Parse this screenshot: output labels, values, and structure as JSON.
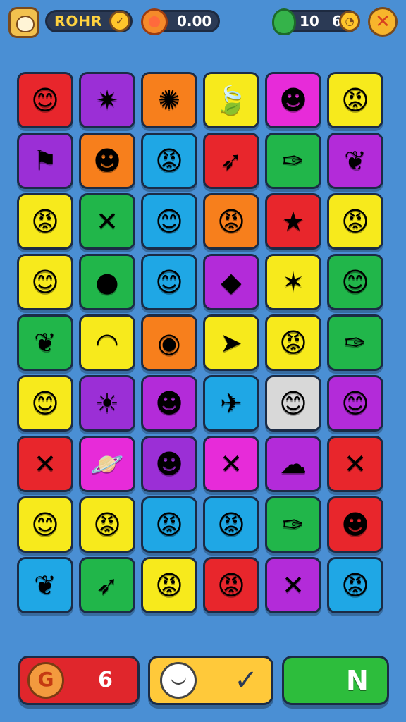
{
  "header": {
    "player_name": "ROHR",
    "name_badge_icon": "coin-icon",
    "score": "0.00",
    "lives": "10",
    "moves": "6",
    "close_icon": "close-icon",
    "close_label": "✕",
    "coin_label": "✓"
  },
  "board": {
    "rows": 9,
    "cols": 6,
    "tiles": [
      {
        "color": "#e8262c",
        "icon": "sun-face",
        "glyph": "😊"
      },
      {
        "color": "#9b2fd6",
        "icon": "star-burst",
        "glyph": "✷"
      },
      {
        "color": "#f77f1c",
        "icon": "splash",
        "glyph": "✺"
      },
      {
        "color": "#f7ea1c",
        "icon": "leaf",
        "glyph": "🍃"
      },
      {
        "color": "#e72bd9",
        "icon": "blue-face",
        "glyph": "☻"
      },
      {
        "color": "#f7ea1c",
        "icon": "red-sun-face",
        "glyph": "😡"
      },
      {
        "color": "#9b2fd6",
        "icon": "flag",
        "glyph": "⚑"
      },
      {
        "color": "#f77f1c",
        "icon": "green-face",
        "glyph": "☻"
      },
      {
        "color": "#1fa7e5",
        "icon": "red-sun-face",
        "glyph": "😡"
      },
      {
        "color": "#e8262c",
        "icon": "rocket",
        "glyph": "➶"
      },
      {
        "color": "#21b64a",
        "icon": "carrot",
        "glyph": "✑"
      },
      {
        "color": "#b32bd9",
        "icon": "leaf",
        "glyph": "❦"
      },
      {
        "color": "#f7ea1c",
        "icon": "red-sun-face",
        "glyph": "😡"
      },
      {
        "color": "#21b64a",
        "icon": "cross-sword",
        "glyph": "✕"
      },
      {
        "color": "#1fa7e5",
        "icon": "orange-sun-face",
        "glyph": "😊"
      },
      {
        "color": "#f77f1c",
        "icon": "red-sun-face",
        "glyph": "😡"
      },
      {
        "color": "#e8262c",
        "icon": "star",
        "glyph": "★"
      },
      {
        "color": "#f7ea1c",
        "icon": "red-sun-face",
        "glyph": "😡"
      },
      {
        "color": "#f7ea1c",
        "icon": "sun-face",
        "glyph": "😊"
      },
      {
        "color": "#21b64a",
        "icon": "orange-coin",
        "glyph": "●"
      },
      {
        "color": "#1fa7e5",
        "icon": "orange-sun-face",
        "glyph": "😊"
      },
      {
        "color": "#b32bd9",
        "icon": "gem",
        "glyph": "◆"
      },
      {
        "color": "#f7ea1c",
        "icon": "purple-star",
        "glyph": "✶"
      },
      {
        "color": "#21b64a",
        "icon": "orange-sun-face",
        "glyph": "😊"
      },
      {
        "color": "#21b64a",
        "icon": "leaf",
        "glyph": "❦"
      },
      {
        "color": "#f7ea1c",
        "icon": "rainbow",
        "glyph": "◠"
      },
      {
        "color": "#f77f1c",
        "icon": "green-orb",
        "glyph": "◉"
      },
      {
        "color": "#f7ea1c",
        "icon": "arrow",
        "glyph": "➤"
      },
      {
        "color": "#f7ea1c",
        "icon": "pink-sun-face",
        "glyph": "😡"
      },
      {
        "color": "#21b64a",
        "icon": "carrot",
        "glyph": "✑"
      },
      {
        "color": "#f7ea1c",
        "icon": "sun-face",
        "glyph": "😊"
      },
      {
        "color": "#9b2fd6",
        "icon": "sun-burst",
        "glyph": "☀"
      },
      {
        "color": "#b32bd9",
        "icon": "blue-sun-face",
        "glyph": "☻"
      },
      {
        "color": "#1fa7e5",
        "icon": "plane",
        "glyph": "✈"
      },
      {
        "color": "#d8d8d8",
        "icon": "sun-face",
        "glyph": "😊"
      },
      {
        "color": "#b32bd9",
        "icon": "sun-face",
        "glyph": "😊"
      },
      {
        "color": "#e8262c",
        "icon": "cross",
        "glyph": "✕"
      },
      {
        "color": "#e72bd9",
        "icon": "planet",
        "glyph": "🪐"
      },
      {
        "color": "#9b2fd6",
        "icon": "green-face",
        "glyph": "☻"
      },
      {
        "color": "#e72bd9",
        "icon": "cross-sword",
        "glyph": "✕"
      },
      {
        "color": "#b32bd9",
        "icon": "blue-blob",
        "glyph": "☁"
      },
      {
        "color": "#e8262c",
        "icon": "cross",
        "glyph": "✕"
      },
      {
        "color": "#f7ea1c",
        "icon": "sun-face",
        "glyph": "😊"
      },
      {
        "color": "#f7ea1c",
        "icon": "pink-sun-face",
        "glyph": "😡"
      },
      {
        "color": "#1fa7e5",
        "icon": "pink-sun-face",
        "glyph": "😡"
      },
      {
        "color": "#1fa7e5",
        "icon": "red-sun-face",
        "glyph": "😡"
      },
      {
        "color": "#21b64a",
        "icon": "carrot",
        "glyph": "✑"
      },
      {
        "color": "#e8262c",
        "icon": "blue-sun-face",
        "glyph": "☻"
      },
      {
        "color": "#1fa7e5",
        "icon": "leaf",
        "glyph": "❦"
      },
      {
        "color": "#21b64a",
        "icon": "rocket",
        "glyph": "➶"
      },
      {
        "color": "#f7ea1c",
        "icon": "red-sun-face",
        "glyph": "😡"
      },
      {
        "color": "#e8262c",
        "icon": "red-sun-face",
        "glyph": "😡"
      },
      {
        "color": "#b32bd9",
        "icon": "cross",
        "glyph": "✕"
      },
      {
        "color": "#1fa7e5",
        "icon": "red-sun-face",
        "glyph": "😡"
      }
    ]
  },
  "footer": {
    "booster_icon": "swirl-icon",
    "booster_glyph": "G",
    "booster_count": "6",
    "hint_icon": "smile-icon",
    "confirm_glyph": "✓",
    "next_label": "N"
  }
}
